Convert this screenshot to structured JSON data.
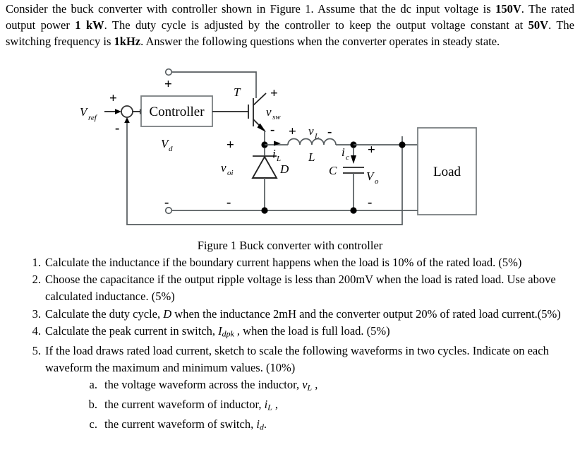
{
  "intro": {
    "segments": [
      {
        "t": "Consider the buck converter with controller shown in Figure 1. Assume that the dc input voltage is ",
        "b": false
      },
      {
        "t": "150V",
        "b": true
      },
      {
        "t": ". The rated output power ",
        "b": false
      },
      {
        "t": "1 kW",
        "b": true
      },
      {
        "t": ". The duty cycle is adjusted by the controller to keep the output voltage constant at ",
        "b": false
      },
      {
        "t": "50V",
        "b": true
      },
      {
        "t": ". The switching frequency is ",
        "b": false
      },
      {
        "t": "1kHz",
        "b": true
      },
      {
        "t": ". Answer the following questions when the converter operates in steady state.",
        "b": false
      }
    ]
  },
  "figure": {
    "caption": "Figure 1 Buck converter with controller",
    "labels": {
      "v_ref": "V",
      "v_ref_sub": "ref",
      "controller": "Controller",
      "v_d": "V",
      "v_d_sub": "d",
      "transistor": "T",
      "v_sw": "v",
      "v_sw_sub": "sw",
      "v_oi": "v",
      "v_oi_sub": "oi",
      "diode": "D",
      "i_L": "i",
      "i_L_sub": "L",
      "v_L": "v",
      "v_L_sub": "L",
      "inductor": "L",
      "i_c": "i",
      "i_c_sub": "c",
      "capacitor": "C",
      "v_o": "V",
      "v_o_sub": "o",
      "load": "Load",
      "plus": "+",
      "minus": "-"
    }
  },
  "questions": [
    {
      "num": "1.",
      "parts": [
        {
          "t": "Calculate the inductance if the boundary current happens when the load is 10% of the rated load. (5%)",
          "style": "plain"
        }
      ]
    },
    {
      "num": "2.",
      "parts": [
        {
          "t": "Choose the capacitance if the output ripple voltage is less than 200mV when the load is rated load. Use above calculated inductance. (5%)",
          "style": "plain"
        }
      ]
    },
    {
      "num": "3.",
      "parts": [
        {
          "t": "Calculate the duty cycle, ",
          "style": "plain"
        },
        {
          "t": "D",
          "style": "italic"
        },
        {
          "t": " when the inductance 2mH and the converter output 20% of rated load current.(5%)",
          "style": "plain"
        }
      ]
    },
    {
      "num": "4.",
      "parts": [
        {
          "t": "Calculate the peak current in switch, ",
          "style": "plain"
        },
        {
          "t": "I",
          "style": "italic"
        },
        {
          "t": "dpk",
          "style": "subscript"
        },
        {
          "t": " , when the load is full load. (5%)",
          "style": "plain"
        }
      ]
    },
    {
      "num": "5.",
      "parts": [
        {
          "t": "If the load draws rated load current, sketch to scale the following waveforms in two cycles. Indicate on each waveform the maximum and minimum values. (10%)",
          "style": "plain"
        }
      ],
      "sub_items": [
        {
          "letter": "a.",
          "parts": [
            {
              "t": "the voltage waveform across the inductor, ",
              "style": "plain"
            },
            {
              "t": "v",
              "style": "italic"
            },
            {
              "t": "L",
              "style": "subscript"
            },
            {
              "t": " ,",
              "style": "plain"
            }
          ]
        },
        {
          "letter": "b.",
          "parts": [
            {
              "t": "the current waveform of inductor, ",
              "style": "plain"
            },
            {
              "t": "i",
              "style": "italic"
            },
            {
              "t": "L",
              "style": "subscript"
            },
            {
              "t": " ,",
              "style": "plain"
            }
          ]
        },
        {
          "letter": "c.",
          "parts": [
            {
              "t": "the current waveform of switch, ",
              "style": "plain"
            },
            {
              "t": "i",
              "style": "italic"
            },
            {
              "t": "d",
              "style": "subscript"
            },
            {
              "t": ".",
              "style": "plain"
            }
          ]
        }
      ]
    }
  ],
  "colors": {
    "wire": "#555b5e",
    "box_border": "#7a7f82",
    "text": "#000000",
    "background": "#ffffff"
  }
}
